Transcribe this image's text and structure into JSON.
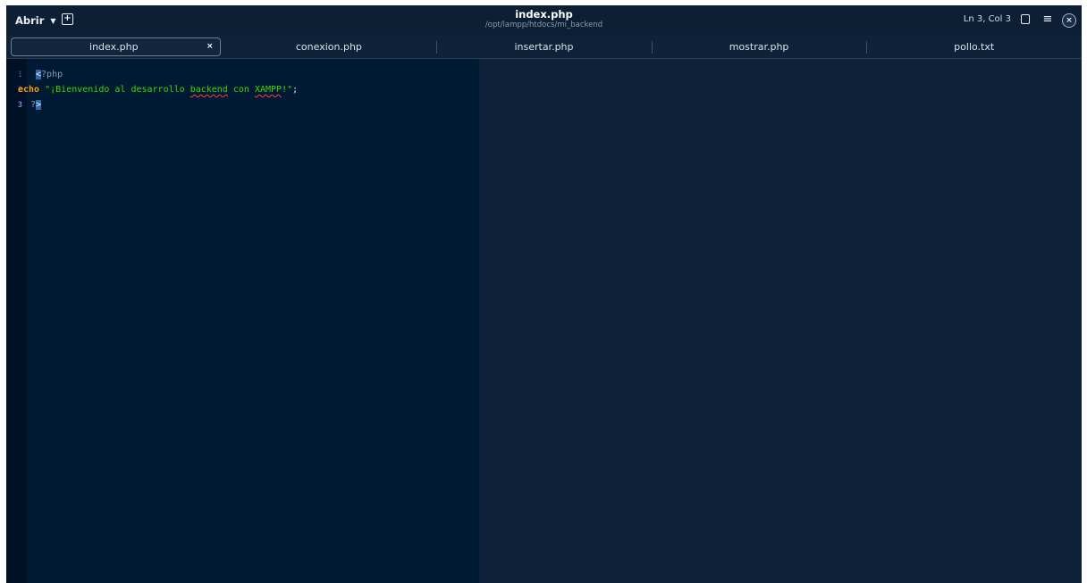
{
  "headerbar": {
    "open_label": "Abrir",
    "open_arrow": "▼",
    "new_tab_glyph": "+",
    "title": "index.php",
    "subtitle": "/opt/lampp/htdocs/mi_backend",
    "cursor_position": "Ln 3, Col 3",
    "save_icon": "save-document-icon",
    "menu_icon": "hamburger-menu-icon",
    "menu_glyph": "≡",
    "close_glyph": "×"
  },
  "tabs": [
    {
      "label": "index.php",
      "active": true,
      "close_glyph": "×"
    },
    {
      "label": "conexion.php",
      "active": false
    },
    {
      "label": "insertar.php",
      "active": false
    },
    {
      "label": "mostrar.php",
      "active": false
    },
    {
      "label": "pollo.txt",
      "active": false
    }
  ],
  "editor": {
    "line_numbers": [
      "1",
      "2",
      "3"
    ],
    "lines": {
      "l1_sel": "<",
      "l1_rest": "?php",
      "l2_kw": "echo",
      "l2_str_a": "\"¡Bienvenido al desarrollo ",
      "l2_err1": "backend",
      "l2_str_b": " con ",
      "l2_err2": "XAMPP",
      "l2_str_c": "!\"",
      "l2_end": ";",
      "l3_a": "?",
      "l3_sel": ">"
    }
  },
  "colors": {
    "editor_bg": "#011a33",
    "keyword": "#ff9d00",
    "string": "#3ad900",
    "window_bg": "#0e2239"
  }
}
